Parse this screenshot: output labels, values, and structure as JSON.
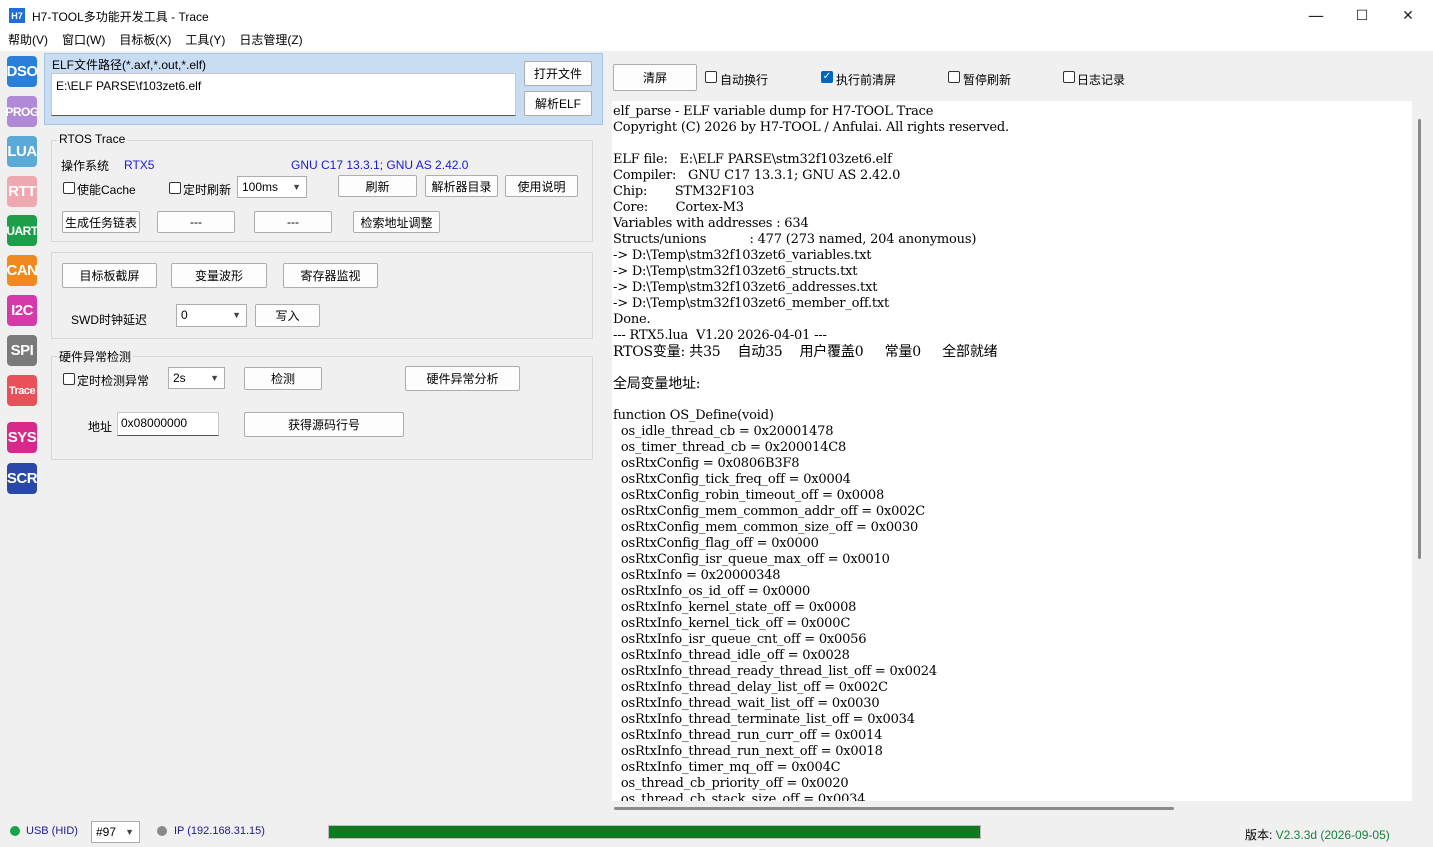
{
  "window": {
    "icon_text": "H7",
    "title": "H7-TOOL多功能开发工具 - Trace",
    "minimize": "—",
    "maximize": "☐",
    "close": "✕"
  },
  "menu": [
    "帮助(V)",
    "窗口(W)",
    "目标板(X)",
    "工具(Y)",
    "日志管理(Z)"
  ],
  "sidebar": [
    {
      "label": "DSO",
      "color": "#2a7fd8"
    },
    {
      "label": "PROG",
      "color": "#b08ad6"
    },
    {
      "label": "LUA",
      "color": "#5aa9d6"
    },
    {
      "label": "RTT",
      "color": "#f0a8b0"
    },
    {
      "label": "UART",
      "color": "#1e9e4a"
    },
    {
      "label": "CAN",
      "color": "#f08a1e"
    },
    {
      "label": "I2C",
      "color": "#d63aa8"
    },
    {
      "label": "SPI",
      "color": "#7a7a7a"
    },
    {
      "label": "Trace",
      "color": "#e8505a"
    },
    {
      "label": "SYS",
      "color": "#d8288a"
    },
    {
      "label": "SCR",
      "color": "#2a48a8"
    }
  ],
  "elf": {
    "label": "ELF文件路径(*.axf,*.out,*.elf)",
    "path": "E:\\ELF PARSE\\f103zet6.elf",
    "open_btn": "打开文件",
    "parse_btn": "解析ELF"
  },
  "rtos": {
    "group_title": "RTOS Trace",
    "os_label": "操作系统",
    "os_value": "RTX5",
    "compiler_value": "GNU C17 13.3.1; GNU AS 2.42.0",
    "cache_label": "使能Cache",
    "timer_label": "定时刷新",
    "interval": "100ms",
    "refresh_btn": "刷新",
    "dir_btn": "解析器目录",
    "help_btn": "使用说明",
    "gen_btn": "生成任务链表",
    "dash1_btn": "---",
    "dash2_btn": "---",
    "addr_adj_btn": "检索地址调整"
  },
  "tools": {
    "screenshot_btn": "目标板截屏",
    "wave_btn": "变量波形",
    "reg_btn": "寄存器监视",
    "swd_label": "SWD时钟延迟",
    "swd_value": "0",
    "write_btn": "写入"
  },
  "hw": {
    "group_title": "硬件异常检测",
    "timer_label": "定时检测异常",
    "interval": "2s",
    "detect_btn": "检测",
    "analyze_btn": "硬件异常分析",
    "addr_label": "地址",
    "addr_value": "0x08000000",
    "src_btn": "获得源码行号"
  },
  "toolbar": {
    "clear_btn": "清屏",
    "autowrap_label": "自动换行",
    "clear_before_label": "执行前清屏",
    "pause_label": "暂停刷新",
    "log_label": "日志记录"
  },
  "console": [
    "elf_parse - ELF variable dump for H7-TOOL Trace",
    "Copyright (C) 2026 by H7-TOOL / Anfulai. All rights reserved.",
    "",
    "ELF file:   E:\\ELF PARSE\\stm32f103zet6.elf",
    "Compiler:   GNU C17 13.3.1; GNU AS 2.42.0",
    "Chip:       STM32F103",
    "Core:       Cortex-M3",
    "Variables with addresses : 634",
    "Structs/unions           : 477 (273 named, 204 anonymous)",
    "-> D:\\Temp\\stm32f103zet6_variables.txt",
    "-> D:\\Temp\\stm32f103zet6_structs.txt",
    "-> D:\\Temp\\stm32f103zet6_addresses.txt",
    "-> D:\\Temp\\stm32f103zet6_member_off.txt",
    "Done.",
    "--- RTX5.lua  V1.20 2026-04-01 ---",
    "RTOS变量: 共35    自动35    用户覆盖0     常量0     全部就绪",
    "",
    "全局变量地址:",
    "",
    "function OS_Define(void)",
    "  os_idle_thread_cb = 0x20001478",
    "  os_timer_thread_cb = 0x200014C8",
    "  osRtxConfig = 0x0806B3F8",
    "  osRtxConfig_tick_freq_off = 0x0004",
    "  osRtxConfig_robin_timeout_off = 0x0008",
    "  osRtxConfig_mem_common_addr_off = 0x002C",
    "  osRtxConfig_mem_common_size_off = 0x0030",
    "  osRtxConfig_flag_off = 0x0000",
    "  osRtxConfig_isr_queue_max_off = 0x0010",
    "  osRtxInfo = 0x20000348",
    "  osRtxInfo_os_id_off = 0x0000",
    "  osRtxInfo_kernel_state_off = 0x0008",
    "  osRtxInfo_kernel_tick_off = 0x000C",
    "  osRtxInfo_isr_queue_cnt_off = 0x0056",
    "  osRtxInfo_thread_idle_off = 0x0028",
    "  osRtxInfo_thread_ready_thread_list_off = 0x0024",
    "  osRtxInfo_thread_delay_list_off = 0x002C",
    "  osRtxInfo_thread_wait_list_off = 0x0030",
    "  osRtxInfo_thread_terminate_list_off = 0x0034",
    "  osRtxInfo_thread_run_curr_off = 0x0014",
    "  osRtxInfo_thread_run_next_off = 0x0018",
    "  osRtxInfo_timer_mq_off = 0x004C",
    "  os_thread_cb_priority_off = 0x0020",
    "  os_thread_cb_stack_size_off = 0x0034"
  ],
  "status": {
    "usb": "USB (HID)",
    "device_no": "#97",
    "ip": "IP (192.168.31.15)",
    "progress_fraction": 1.0,
    "version_label": "版本: ",
    "version_value": "V2.3.3d (2026-09-05)"
  }
}
